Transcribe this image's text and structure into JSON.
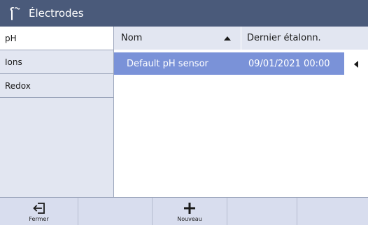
{
  "window": {
    "title": "Électrodes",
    "icon": "electrode-icon"
  },
  "sidebar": {
    "items": [
      {
        "label": "pH",
        "active": true
      },
      {
        "label": "Ions",
        "active": false
      },
      {
        "label": "Redox",
        "active": false
      }
    ]
  },
  "table": {
    "columns": [
      {
        "label": "Nom",
        "sort": "ascending"
      },
      {
        "label": "Dernier étalonn."
      }
    ],
    "rows": [
      {
        "name": "Default pH sensor",
        "last_calibration": "09/01/2021 00:00",
        "selected": true
      }
    ]
  },
  "footer": {
    "buttons": [
      {
        "label": "Fermer",
        "icon": "exit-icon"
      },
      {
        "label": "",
        "icon": ""
      },
      {
        "label": "Nouveau",
        "icon": "plus-icon"
      },
      {
        "label": "",
        "icon": ""
      },
      {
        "label": "",
        "icon": ""
      }
    ]
  },
  "colors": {
    "titlebar": "#4a5a7a",
    "panel": "#e2e6f1",
    "selected_row": "#7a92d8",
    "footer": "#d8ddee"
  }
}
